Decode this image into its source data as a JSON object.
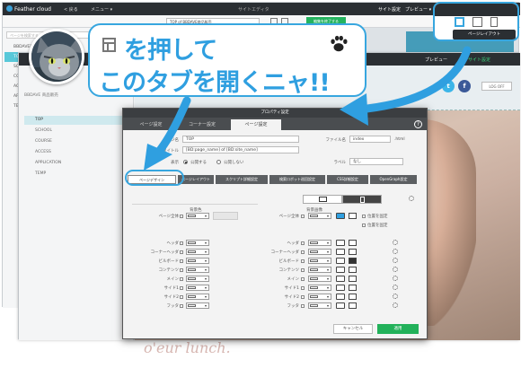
{
  "app": {
    "logo_text": "Feather cloud",
    "menu_back": "< 戻る",
    "menu_main": "メニュー ▾",
    "menu_site_editor": "サイトエディタ",
    "menu_site_settings": "サイト設定",
    "menu_preview": "プレビュー ▾",
    "page_select": "TOP of BBDAVE商品販売",
    "publish_button": "編集を終了する",
    "search_placeholder": "ページを検索する",
    "pages_title": "BBDAVE 商品販売",
    "pages_root": "BBDAVE商品販売",
    "pages": [
      "TOP",
      "SCHOOL",
      "COURSE",
      "ACCESS",
      "APPLICATION",
      "TEMP"
    ],
    "active_page": "TOP",
    "tooltip": "ページレイアウト",
    "site_label": "サイト設定",
    "preview_label": "プレビュー",
    "login_label": "LOG OFF"
  },
  "instruction": {
    "line1": "を押して",
    "line2": "このタブを開くニャ!!"
  },
  "dialog": {
    "title": "プロパティ設定",
    "tabs": [
      "ページ設定",
      "コーナー設定",
      "ページ設定"
    ],
    "active_tab": 2,
    "page_name_label": "ページ名",
    "page_name_value": "TOP",
    "file_name_label": "ファイル名",
    "file_name_value": "index",
    "file_ext": ".html",
    "title_label": "タイトル",
    "title_value": "[BD:page_name] of [BD:site_name]",
    "show_label": "表示",
    "show_options": [
      "公開する",
      "公開しない"
    ],
    "show_selected": 0,
    "label_label": "ラベル",
    "label_value": "なし",
    "subtabs": [
      "ページデザイン",
      "ページレイアウト",
      "スクリプト詳細設定",
      "検索ロボット巡回設定",
      "CSS詳細設定",
      "OpenGraph設定"
    ],
    "active_subtab": 0,
    "bg_color_title": "背景色",
    "bg_image_title": "背景画像",
    "rows": [
      "ページ全体",
      "ヘッダ",
      "コーナーヘッダ",
      "ビルボード",
      "コンテンツ",
      "メイン",
      "サイド1",
      "サイド2",
      "フッタ"
    ],
    "repeat_label": "位置を固定",
    "cancel_button": "キャンセル",
    "apply_button": "適用"
  },
  "background": {
    "hero_text": "o'eur lunch."
  },
  "colors": {
    "accent": "#2f9fe0",
    "active_page": "#58c8d9",
    "apply_green": "#22b15a",
    "dark_bar": "#2b2f33"
  }
}
